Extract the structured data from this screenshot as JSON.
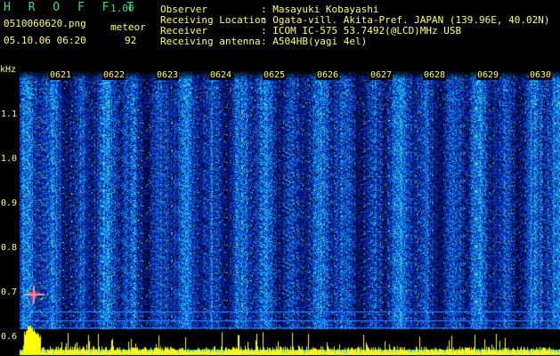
{
  "app": {
    "title": "H R O F F T",
    "version": "1.00",
    "filename": "0510060620.png",
    "datetime": "05.10.06 06:20",
    "mode_label": "meteor",
    "count": "92"
  },
  "info": [
    {
      "label": "Observer",
      "value": ": Masayuki Kobayashi"
    },
    {
      "label": "Receiving Location",
      "value": ": Ogata-vill. Akita-Pref. JAPAN (139.96E, 40.02N)"
    },
    {
      "label": "Receiver",
      "value": ": ICOM IC-575 53.7492(@LCD)MHz USB"
    },
    {
      "label": "Receiving antenna",
      "value": ": A504HB(yagi 4el)"
    }
  ],
  "axis": {
    "y_unit": "kHz",
    "y_ticks": [
      "1.1",
      "1.0",
      "0.9",
      "0.8",
      "0.7",
      "0.6"
    ],
    "x_ticks": [
      "0621",
      "0622",
      "0623",
      "0624",
      "0625",
      "0626",
      "0627",
      "0628",
      "0629",
      "0630"
    ]
  },
  "colors": {
    "background": "#000000",
    "text": "#ffff66",
    "title": "#2fe07a",
    "spectrum_low": "#00186a",
    "spectrum_mid": "#0a52d8",
    "spectrum_high": "#22c8e8",
    "meteor": "#ff3344",
    "amplitude": "#ffff00",
    "baseline": "#22d8ff"
  }
}
